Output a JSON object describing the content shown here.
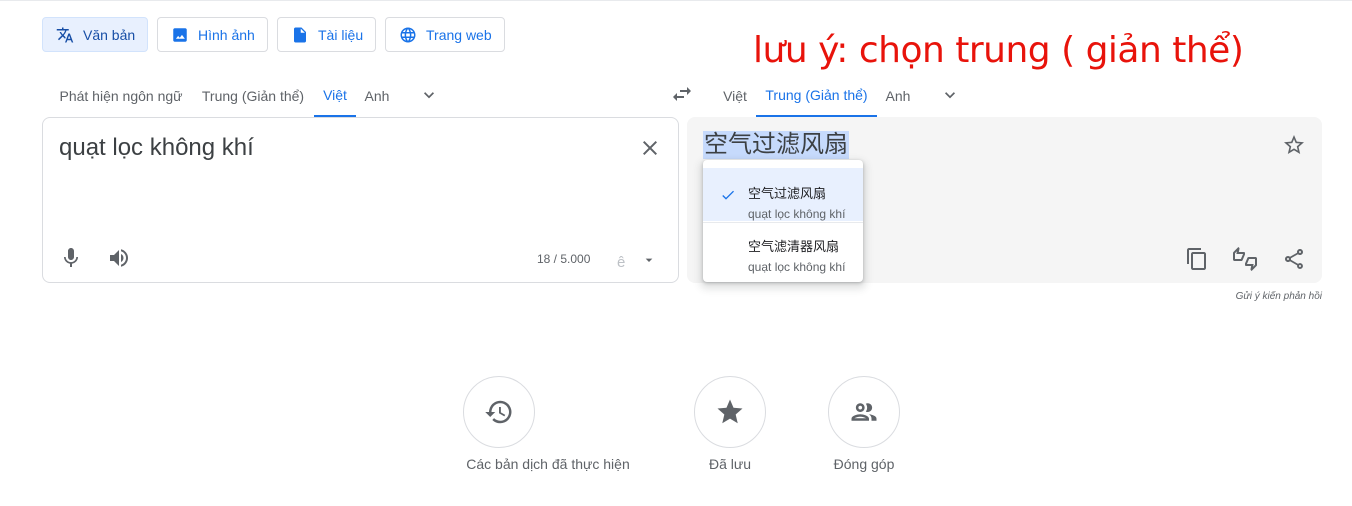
{
  "modes": [
    {
      "label": "Văn bản",
      "icon": "translate-icon",
      "active": true
    },
    {
      "label": "Hình ảnh",
      "icon": "image-icon",
      "active": false
    },
    {
      "label": "Tài liệu",
      "icon": "document-icon",
      "active": false
    },
    {
      "label": "Trang web",
      "icon": "globe-icon",
      "active": false
    }
  ],
  "annotation": "lưu ý: chọn trung ( giản thể)",
  "source_langs": {
    "detect": "Phát hiện ngôn ngữ",
    "chinese": "Trung (Giản thể)",
    "vietnamese": "Việt",
    "english": "Anh",
    "active": "Việt"
  },
  "target_langs": {
    "vietnamese": "Việt",
    "chinese": "Trung (Giản thể)",
    "english": "Anh",
    "active": "Trung (Giản thể)"
  },
  "source": {
    "text": "quạt lọc không khí",
    "char_count": "18 / 5.000",
    "input_tool_glyph": "ê"
  },
  "target": {
    "text": "空气过滤风扇"
  },
  "alternatives": [
    {
      "main": "空气过滤风扇",
      "sub": "quạt lọc không khí",
      "selected": true
    },
    {
      "main": "空气滤清器风扇",
      "sub": "quạt lọc không khí",
      "selected": false
    }
  ],
  "feedback": "Gửi ý kiến phản hồi",
  "bottom": {
    "history": "Các bản dịch đã thực hiện",
    "saved": "Đã lưu",
    "contribute": "Đóng góp"
  },
  "colors": {
    "accent": "#1a73e8",
    "annotation": "#e8130b",
    "selection": "#c6dafc"
  }
}
